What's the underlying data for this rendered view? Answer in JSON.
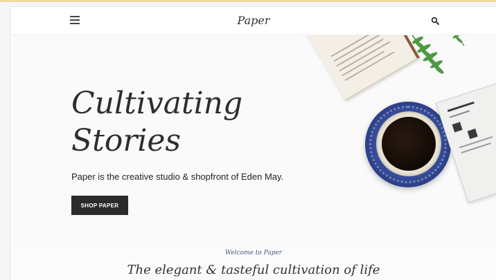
{
  "header": {
    "brand": "Paper",
    "menu_icon": "hamburger-menu-icon",
    "search_icon": "search-icon"
  },
  "hero": {
    "title_line1": "Cultivating",
    "title_line2": "Stories",
    "subtitle": "Paper is the creative studio & shopfront of Eden May.",
    "cta_label": "SHOP PAPER"
  },
  "intro": {
    "welcome": "Welcome to Paper",
    "tagline": "The elegant & tasteful cultivation of life"
  },
  "colors": {
    "button_bg": "#2b2b2b",
    "accent_blue": "#4a5a8a",
    "text_dark": "#2e2e2e"
  }
}
